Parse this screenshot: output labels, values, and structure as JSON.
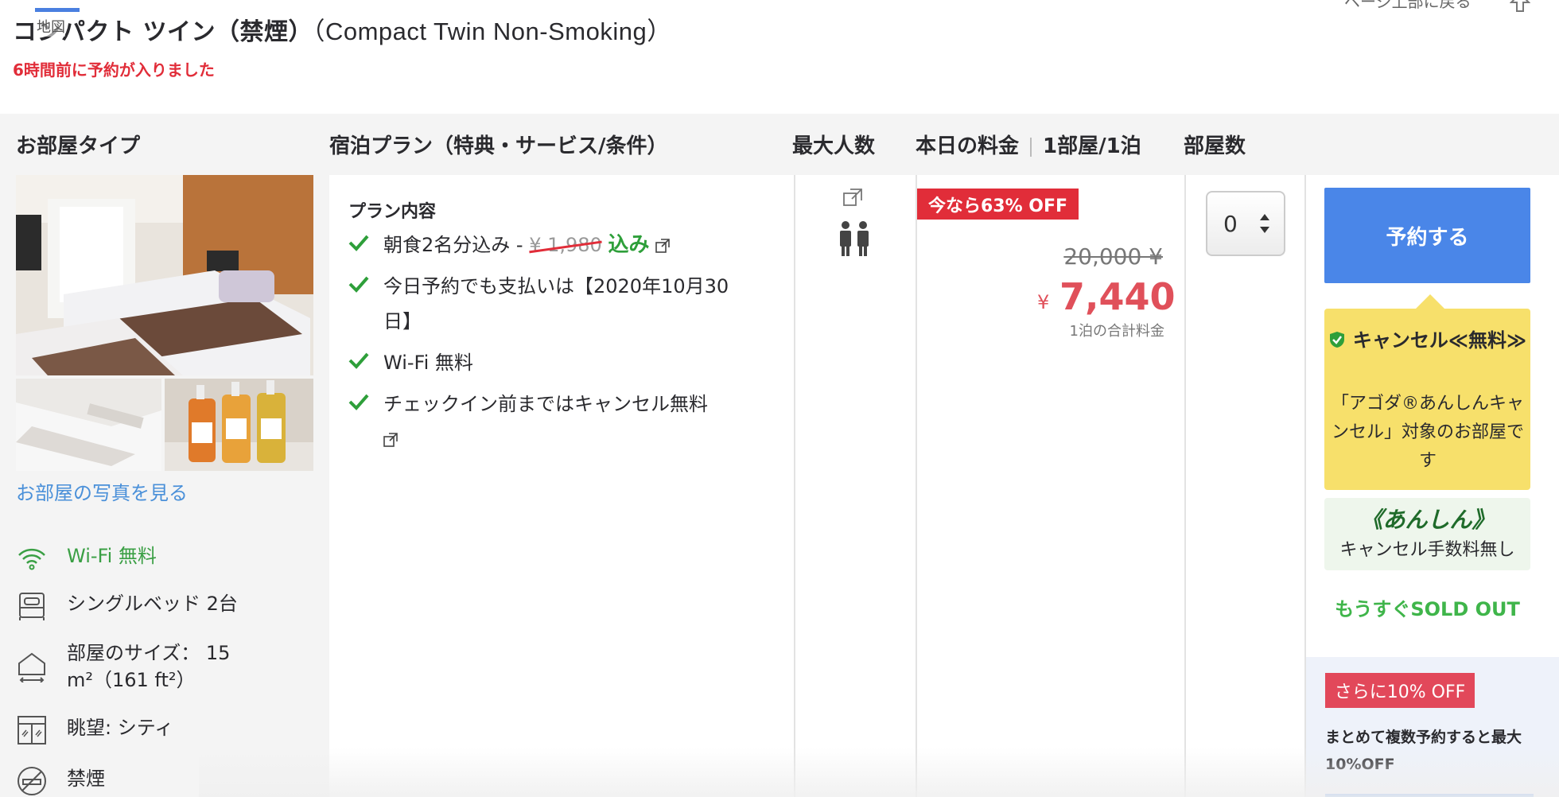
{
  "top": {
    "tab_label": "地図",
    "room_title_ja": "コンパクト ツイン（禁煙）",
    "room_title_en": "（Compact Twin Non-Smoking）",
    "booked_notice": "6時間前に予約が入りました",
    "back_to_top": "ページ上部に戻る"
  },
  "table_header": {
    "room_type": "お部屋タイプ",
    "plan": "宿泊プラン（特典・サービス/条件）",
    "max_guests": "最大人数",
    "price_label": "本日の料金",
    "price_unit": "1部屋/1泊",
    "rooms": "部屋数"
  },
  "room_type": {
    "see_photos": "お部屋の写真を見る",
    "features": [
      {
        "icon": "wifi-icon",
        "label": "Wi-Fi 無料",
        "color": "#3a9f44"
      },
      {
        "icon": "bed-icon",
        "label": "シングルベッド 2台"
      },
      {
        "icon": "room-size-icon",
        "label": "部屋のサイズ： 15 m²（161 ft²）"
      },
      {
        "icon": "window-view-icon",
        "label": "眺望: シティ"
      },
      {
        "icon": "no-smoking-icon",
        "label": "禁煙"
      }
    ]
  },
  "plan": {
    "title": "プラン内容",
    "items": [
      {
        "prefix": "朝食2名分込み - ",
        "struck_price": "¥ 1,980",
        "included": "込み",
        "has_link_icon": true
      },
      {
        "text": "今日予約でも支払いは【2020年10月30日】"
      },
      {
        "text": "Wi-Fi 無料"
      },
      {
        "text": "チェックイン前まではキャンセル無料",
        "has_link_icon": true
      }
    ]
  },
  "occupancy": {
    "guests": 2,
    "icon": "two-people-icon"
  },
  "price": {
    "discount_badge": "今なら63% OFF",
    "original": "20,000 ¥",
    "currency": "¥",
    "current": "7,440",
    "note": "1泊の合計料金",
    "accent": "#e0505a"
  },
  "rooms": {
    "selected": "0"
  },
  "booking": {
    "button": "予約する",
    "cancel_title": "キャンセル≪無料≫",
    "cancel_desc": "「アゴダ®あんしんキャンセル」対象のお部屋です",
    "anshin_title": "《あんしん》",
    "anshin_sub": "キャンセル手数料無し",
    "soldout": "もうすぐSOLD OUT",
    "promo_badge": "さらに10% OFF",
    "promo_text": "まとめて複数予約すると最大10%OFF",
    "button_color": "#4a86e8"
  }
}
